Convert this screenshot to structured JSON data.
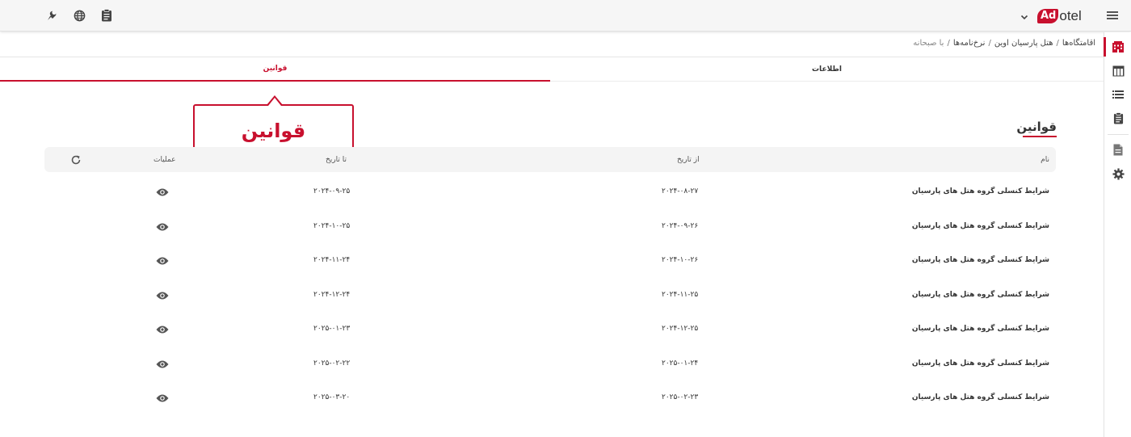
{
  "header": {
    "logo_ad": "Ad",
    "logo_otel": "otel"
  },
  "breadcrumb": {
    "items": [
      "اقامتگاه‌ها",
      "هتل پارسیان اوین",
      "نرخ‌نامه‌ها"
    ],
    "current": "با صبحانه"
  },
  "tabs": {
    "info": "اطلاعات",
    "rules": "قوانین"
  },
  "callout": {
    "text": "قوانین"
  },
  "section": {
    "title": "قوانین"
  },
  "table": {
    "headers": {
      "name": "نام",
      "from": "از تاریخ",
      "to": "تا تاریخ",
      "actions": "عملیات"
    },
    "rows": [
      {
        "name": "شرایط کنسلی گروه هتل های پارسیان",
        "from": "۲۰۲۴-۰۸-۲۷",
        "to": "۲۰۲۴-۰۹-۲۵"
      },
      {
        "name": "شرایط کنسلی گروه هتل های پارسیان",
        "from": "۲۰۲۴-۰۹-۲۶",
        "to": "۲۰۲۴-۱۰-۲۵"
      },
      {
        "name": "شرایط کنسلی گروه هتل های پارسیان",
        "from": "۲۰۲۴-۱۰-۲۶",
        "to": "۲۰۲۴-۱۱-۲۴"
      },
      {
        "name": "شرایط کنسلی گروه هتل های پارسیان",
        "from": "۲۰۲۴-۱۱-۲۵",
        "to": "۲۰۲۴-۱۲-۲۴"
      },
      {
        "name": "شرایط کنسلی گروه هتل های پارسیان",
        "from": "۲۰۲۴-۱۲-۲۵",
        "to": "۲۰۲۵-۰۱-۲۳"
      },
      {
        "name": "شرایط کنسلی گروه هتل های پارسیان",
        "from": "۲۰۲۵-۰۱-۲۴",
        "to": "۲۰۲۵-۰۲-۲۲"
      },
      {
        "name": "شرایط کنسلی گروه هتل های پارسیان",
        "from": "۲۰۲۵-۰۲-۲۳",
        "to": "۲۰۲۵-۰۳-۲۰"
      }
    ]
  },
  "icons": {
    "top": [
      "night-mode-icon",
      "globe-icon",
      "clipboard-icon"
    ],
    "sidebar": [
      "hotel-icon",
      "table-icon",
      "list-icon",
      "clipboard-icon",
      "document-icon",
      "gear-icon"
    ]
  },
  "colors": {
    "accent": "#c8102e"
  }
}
